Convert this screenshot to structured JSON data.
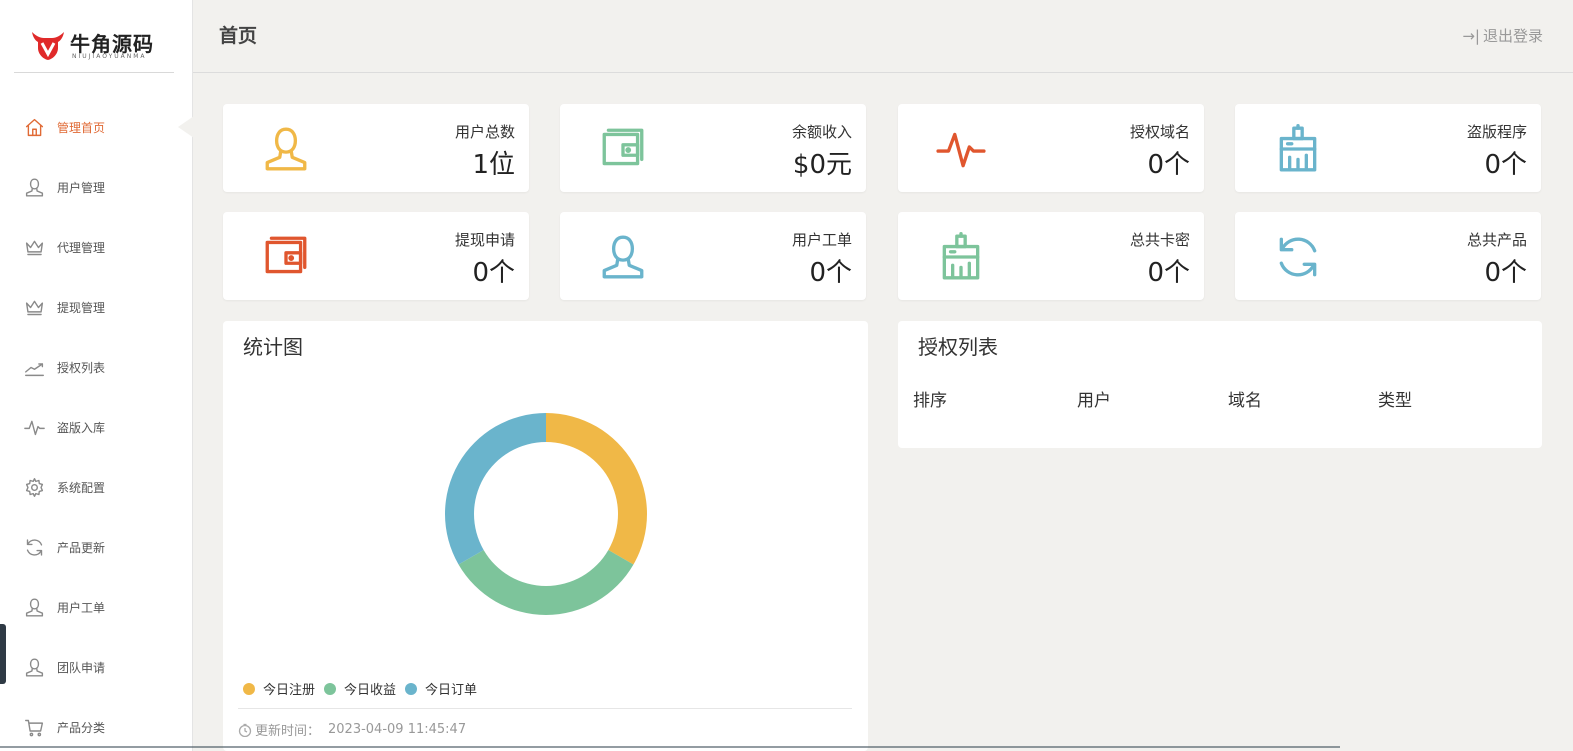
{
  "brand": {
    "name": "牛角源码",
    "sub": "NIUJIAOYUANMA"
  },
  "header": {
    "title": "首页",
    "logout": "退出登录"
  },
  "sidebar": {
    "items": [
      {
        "label": "管理首页",
        "icon": "home-icon",
        "active": true
      },
      {
        "label": "用户管理",
        "icon": "user-icon"
      },
      {
        "label": "代理管理",
        "icon": "crown-icon"
      },
      {
        "label": "提现管理",
        "icon": "crown-icon"
      },
      {
        "label": "授权列表",
        "icon": "trend-icon"
      },
      {
        "label": "盗版入库",
        "icon": "pulse-icon"
      },
      {
        "label": "系统配置",
        "icon": "gear-icon"
      },
      {
        "label": "产品更新",
        "icon": "refresh-icon"
      },
      {
        "label": "用户工单",
        "icon": "user-icon"
      },
      {
        "label": "团队申请",
        "icon": "user-icon"
      },
      {
        "label": "产品分类",
        "icon": "cart-icon"
      }
    ]
  },
  "stats": [
    {
      "label": "用户总数",
      "value": "1位",
      "icon": "user-icon",
      "color": "#f0b847"
    },
    {
      "label": "余额收入",
      "value": "$0元",
      "icon": "wallet-icon",
      "color": "#7dc49b"
    },
    {
      "label": "授权域名",
      "value": "0个",
      "icon": "pulse-icon",
      "color": "#e0562e"
    },
    {
      "label": "盗版程序",
      "value": "0个",
      "icon": "brush-icon",
      "color": "#6ab4cc"
    },
    {
      "label": "提现申请",
      "value": "0个",
      "icon": "wallet-icon",
      "color": "#e0562e"
    },
    {
      "label": "用户工单",
      "value": "0个",
      "icon": "user-icon",
      "color": "#6ab4cc"
    },
    {
      "label": "总共卡密",
      "value": "0个",
      "icon": "brush-icon",
      "color": "#7dc49b"
    },
    {
      "label": "总共产品",
      "value": "0个",
      "icon": "refresh-icon",
      "color": "#6ab4cc"
    }
  ],
  "chart_panel": {
    "title": "统计图",
    "update_label": "更新时间：",
    "update_time": "2023-04-09 11:45:47"
  },
  "chart_data": {
    "type": "pie",
    "style": "donut",
    "series": [
      {
        "name": "今日注册",
        "value": 1,
        "color": "#f0b847"
      },
      {
        "name": "今日收益",
        "value": 1,
        "color": "#7dc49b"
      },
      {
        "name": "今日订单",
        "value": 1,
        "color": "#6ab4cc"
      }
    ],
    "legend": "bottom-left"
  },
  "auth_panel": {
    "title": "授权列表",
    "columns": [
      "排序",
      "用户",
      "域名",
      "类型"
    ]
  }
}
